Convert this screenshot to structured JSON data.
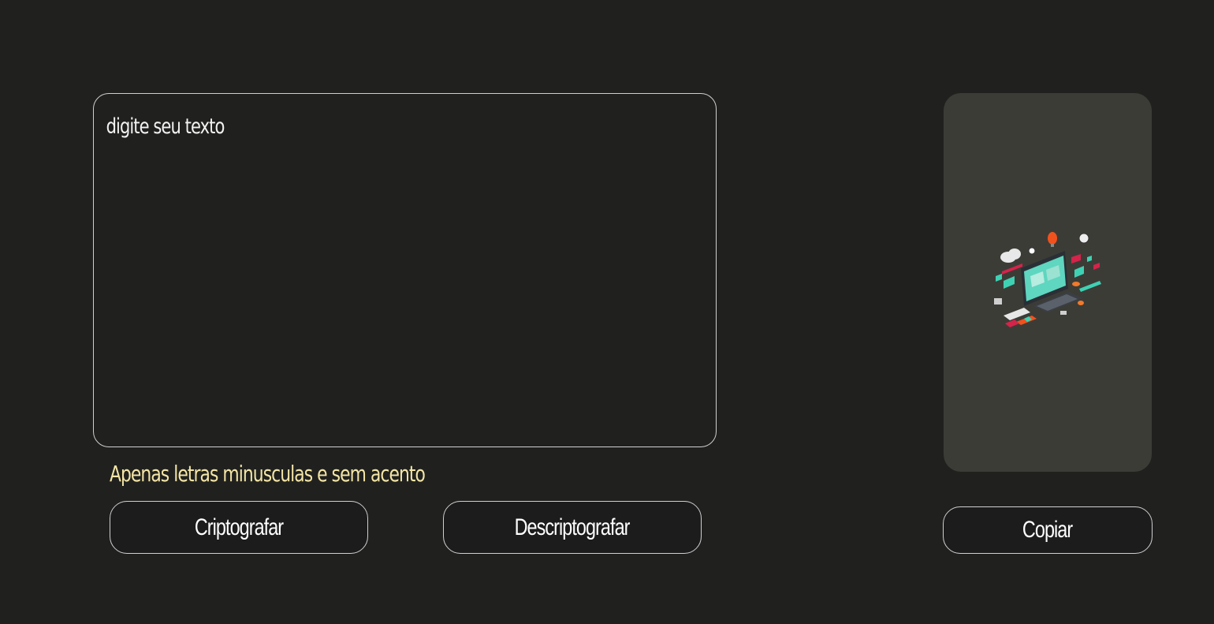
{
  "input": {
    "placeholder": "digite seu texto",
    "value": ""
  },
  "hint": "Apenas letras minusculas e sem acento",
  "buttons": {
    "encrypt": "Criptografar",
    "decrypt": "Descriptografar",
    "copy": "Copiar"
  },
  "output": {
    "illustration_icon": "isometric-computer-illustration-icon"
  },
  "colors": {
    "background": "#20211f",
    "panel": "#3c3c37",
    "hint_text": "#f4e5a6",
    "text": "#ffffff"
  }
}
